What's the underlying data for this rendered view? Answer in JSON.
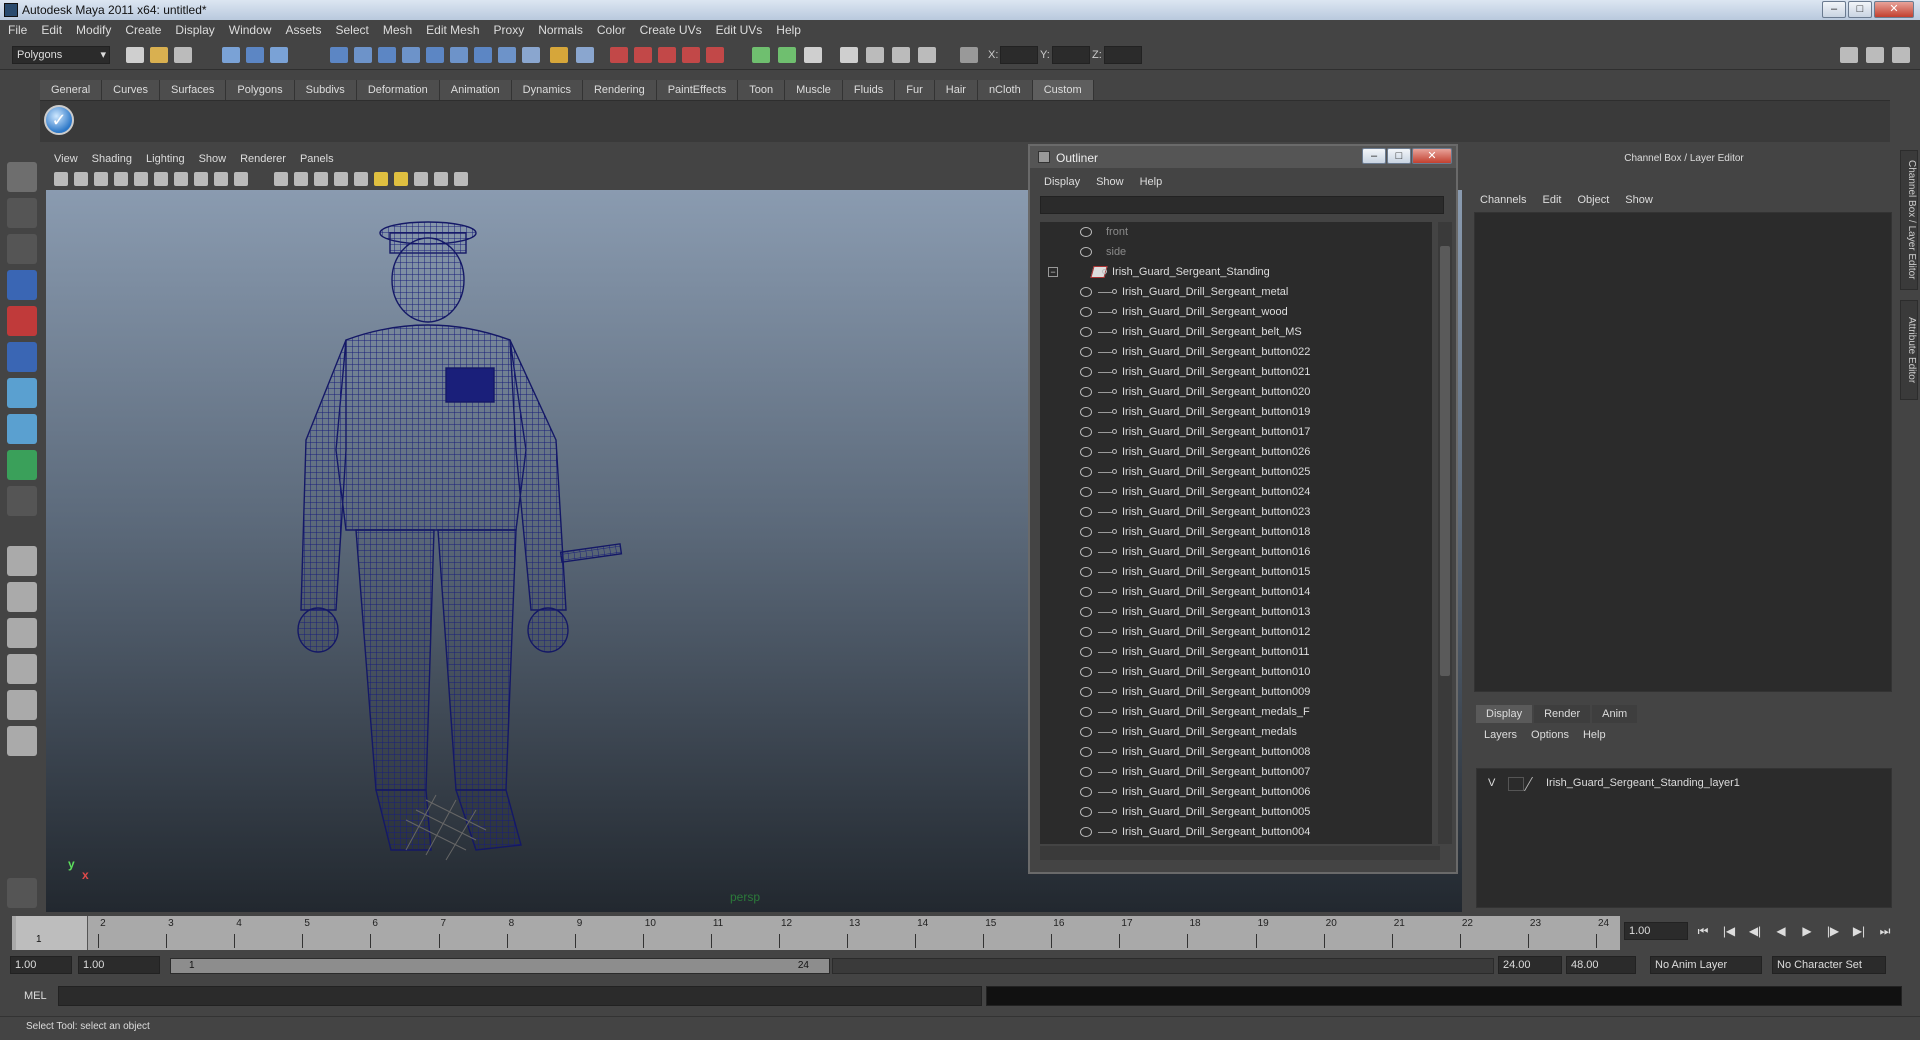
{
  "window": {
    "title": "Autodesk Maya 2011 x64: untitled*"
  },
  "menubar": [
    "File",
    "Edit",
    "Modify",
    "Create",
    "Display",
    "Window",
    "Assets",
    "Select",
    "Mesh",
    "Edit Mesh",
    "Proxy",
    "Normals",
    "Color",
    "Create UVs",
    "Edit UVs",
    "Help"
  ],
  "statusline": {
    "mode": "Polygons",
    "x_label": "X:",
    "y_label": "Y:",
    "z_label": "Z:"
  },
  "shelf": {
    "tabs": [
      "General",
      "Curves",
      "Surfaces",
      "Polygons",
      "Subdivs",
      "Deformation",
      "Animation",
      "Dynamics",
      "Rendering",
      "PaintEffects",
      "Toon",
      "Muscle",
      "Fluids",
      "Fur",
      "Hair",
      "nCloth",
      "Custom"
    ],
    "active_tab": "Custom"
  },
  "viewport": {
    "menu": [
      "View",
      "Shading",
      "Lighting",
      "Show",
      "Renderer",
      "Panels"
    ],
    "camera_label": "persp",
    "axis_y": "y",
    "axis_x": "x",
    "mesh_color": "#1a1f7a"
  },
  "outliner": {
    "title": "Outliner",
    "menu": [
      "Display",
      "Show",
      "Help"
    ],
    "cameras": [
      "front",
      "side"
    ],
    "group": "Irish_Guard_Sergeant_Standing",
    "children": [
      "Irish_Guard_Drill_Sergeant_metal",
      "Irish_Guard_Drill_Sergeant_wood",
      "Irish_Guard_Drill_Sergeant_belt_MS",
      "Irish_Guard_Drill_Sergeant_button022",
      "Irish_Guard_Drill_Sergeant_button021",
      "Irish_Guard_Drill_Sergeant_button020",
      "Irish_Guard_Drill_Sergeant_button019",
      "Irish_Guard_Drill_Sergeant_button017",
      "Irish_Guard_Drill_Sergeant_button026",
      "Irish_Guard_Drill_Sergeant_button025",
      "Irish_Guard_Drill_Sergeant_button024",
      "Irish_Guard_Drill_Sergeant_button023",
      "Irish_Guard_Drill_Sergeant_button018",
      "Irish_Guard_Drill_Sergeant_button016",
      "Irish_Guard_Drill_Sergeant_button015",
      "Irish_Guard_Drill_Sergeant_button014",
      "Irish_Guard_Drill_Sergeant_button013",
      "Irish_Guard_Drill_Sergeant_button012",
      "Irish_Guard_Drill_Sergeant_button011",
      "Irish_Guard_Drill_Sergeant_button010",
      "Irish_Guard_Drill_Sergeant_button009",
      "Irish_Guard_Drill_Sergeant_medals_F",
      "Irish_Guard_Drill_Sergeant_medals",
      "Irish_Guard_Drill_Sergeant_button008",
      "Irish_Guard_Drill_Sergeant_button007",
      "Irish_Guard_Drill_Sergeant_button006",
      "Irish_Guard_Drill_Sergeant_button005",
      "Irish_Guard_Drill_Sergeant_button004"
    ]
  },
  "channel_box": {
    "header": "Channel Box / Layer Editor",
    "menu": [
      "Channels",
      "Edit",
      "Object",
      "Show"
    ],
    "side_tabs": [
      "Channel Box / Layer Editor",
      "Attribute Editor"
    ]
  },
  "layer_editor": {
    "tabs": [
      "Display",
      "Render",
      "Anim"
    ],
    "active_tab": "Display",
    "menu": [
      "Layers",
      "Options",
      "Help"
    ],
    "layer": {
      "visible": "V",
      "name": "Irish_Guard_Sergeant_Standing_layer1"
    }
  },
  "timeline": {
    "ticks": [
      "1",
      "2",
      "3",
      "4",
      "5",
      "6",
      "7",
      "8",
      "9",
      "10",
      "11",
      "12",
      "13",
      "14",
      "15",
      "16",
      "17",
      "18",
      "19",
      "20",
      "21",
      "22",
      "23",
      "24"
    ],
    "current_frame": "1",
    "current_time": "1.00"
  },
  "range": {
    "start_time": "1.00",
    "playback_start": "1.00",
    "range_start": "1",
    "range_end": "24",
    "playback_end": "24.00",
    "end_time": "48.00",
    "anim_layer": "No Anim Layer",
    "character_set": "No Character Set"
  },
  "command": {
    "label": "MEL"
  },
  "helpline": "Select Tool: select an object"
}
